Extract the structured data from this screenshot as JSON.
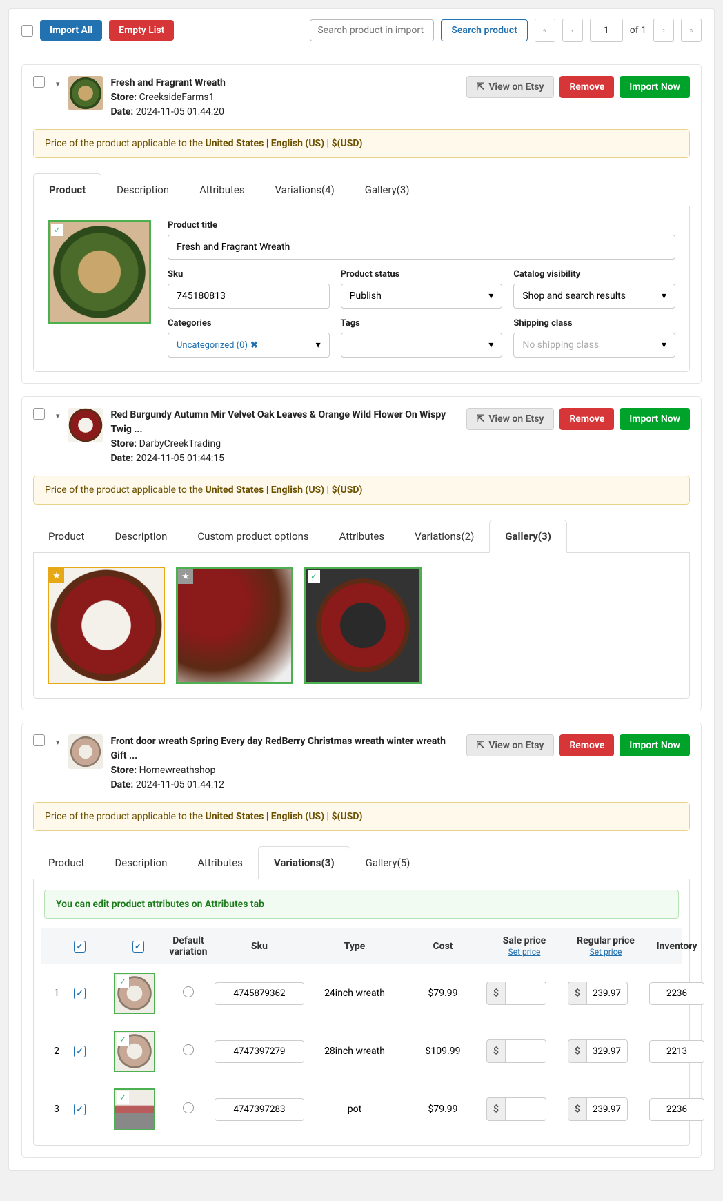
{
  "toolbar": {
    "import_all": "Import All",
    "empty_list": "Empty List",
    "search_placeholder": "Search product in import list",
    "search_btn": "Search product",
    "page": "1",
    "of": "of 1"
  },
  "products": [
    {
      "title": "Fresh and Fragrant Wreath",
      "store_label": "Store:",
      "store": "CreeksideFarms1",
      "date_label": "Date:",
      "date": "2024-11-05 01:44:20",
      "view": "View on Etsy",
      "remove": "Remove",
      "import": "Import Now",
      "notice_pre": "Price of the product applicable to the ",
      "notice_locale": "United States | English (US) | $(USD)",
      "tabs": [
        "Product",
        "Description",
        "Attributes",
        "Variations(4)",
        "Gallery(3)"
      ],
      "active_tab": 0,
      "form": {
        "title_label": "Product title",
        "title_value": "Fresh and Fragrant Wreath",
        "sku_label": "Sku",
        "sku_value": "745180813",
        "status_label": "Product status",
        "status_value": "Publish",
        "vis_label": "Catalog visibility",
        "vis_value": "Shop and search results",
        "cat_label": "Categories",
        "cat_value": "Uncategorized (0)",
        "tags_label": "Tags",
        "tags_value": "",
        "ship_label": "Shipping class",
        "ship_value": "No shipping class"
      }
    },
    {
      "title": "Red Burgundy Autumn Mir Velvet Oak Leaves & Orange Wild Flower On Wispy Twig ...",
      "store_label": "Store:",
      "store": "DarbyCreekTrading",
      "date_label": "Date:",
      "date": "2024-11-05 01:44:15",
      "view": "View on Etsy",
      "remove": "Remove",
      "import": "Import Now",
      "notice_pre": "Price of the product applicable to the ",
      "notice_locale": "United States | English (US) | $(USD)",
      "tabs": [
        "Product",
        "Description",
        "Custom product options",
        "Attributes",
        "Variations(2)",
        "Gallery(3)"
      ],
      "active_tab": 5
    },
    {
      "title": "Front door wreath Spring Every day RedBerry Christmas wreath winter wreath Gift ...",
      "store_label": "Store:",
      "store": "Homewreathshop",
      "date_label": "Date:",
      "date": "2024-11-05 01:44:12",
      "view": "View on Etsy",
      "remove": "Remove",
      "import": "Import Now",
      "notice_pre": "Price of the product applicable to the ",
      "notice_locale": "United States | English (US) | $(USD)",
      "tabs": [
        "Product",
        "Description",
        "Attributes",
        "Variations(3)",
        "Gallery(5)"
      ],
      "active_tab": 3,
      "hint": "You can edit product attributes on Attributes tab",
      "var_head": {
        "default": "Default variation",
        "sku": "Sku",
        "type": "Type",
        "cost": "Cost",
        "sale": "Sale price",
        "set": "Set price",
        "regular": "Regular price",
        "inv": "Inventory"
      },
      "variations": [
        {
          "n": "1",
          "sku": "4745879362",
          "type": "24inch wreath",
          "cost": "$79.99",
          "sale": "",
          "reg": "239.97",
          "inv": "2236"
        },
        {
          "n": "2",
          "sku": "4747397279",
          "type": "28inch wreath",
          "cost": "$109.99",
          "sale": "",
          "reg": "329.97",
          "inv": "2213"
        },
        {
          "n": "3",
          "sku": "4747397283",
          "type": "pot",
          "cost": "$79.99",
          "sale": "",
          "reg": "239.97",
          "inv": "2236"
        }
      ]
    }
  ]
}
